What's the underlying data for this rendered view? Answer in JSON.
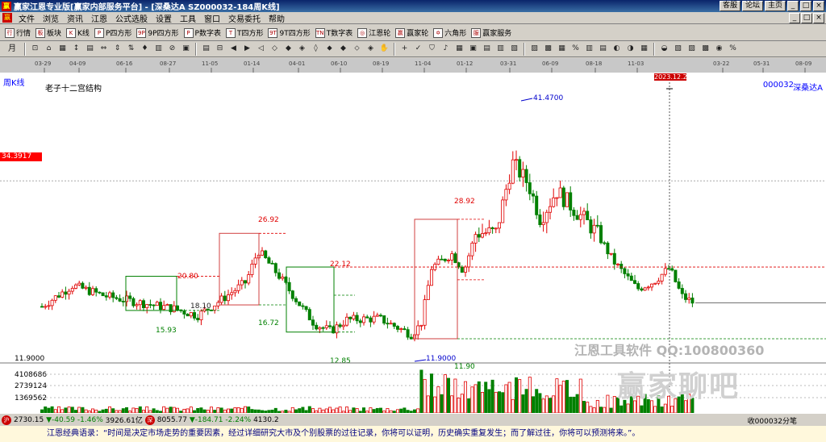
{
  "window": {
    "title": "赢家江恩专业版[赢家内部服务平台] - [深桑达A  SZ000032-184周K线]",
    "buttons": [
      "客服",
      "论坛",
      "主页"
    ],
    "controls": [
      "_",
      "□",
      "×"
    ]
  },
  "menu": {
    "items": [
      "文件",
      "浏览",
      "资讯",
      "江恩",
      "公式选股",
      "设置",
      "工具",
      "窗口",
      "交易委托",
      "帮助"
    ]
  },
  "toolbar1": {
    "items": [
      {
        "icon": "行",
        "label": "行情"
      },
      {
        "icon": "板",
        "label": "板块"
      },
      {
        "icon": "K",
        "label": "K线"
      },
      {
        "icon": "P",
        "label": "P四方形"
      },
      {
        "icon": "9P",
        "label": "9P四方形"
      },
      {
        "icon": "P",
        "label": "P数字表"
      },
      {
        "icon": "T",
        "label": "T四方形"
      },
      {
        "icon": "9T",
        "label": "9T四方形"
      },
      {
        "icon": "TN",
        "label": "T数字表"
      },
      {
        "icon": "◎",
        "label": "江恩轮"
      },
      {
        "icon": "赢",
        "label": "赢家轮"
      },
      {
        "icon": "✡",
        "label": "六角形"
      },
      {
        "icon": "服",
        "label": "赢家服务"
      }
    ]
  },
  "toolbar2": {
    "period_label": "月",
    "icons": [
      "⊡",
      "⌂",
      "▦",
      "↕",
      "▤",
      "⇔",
      "⇕",
      "⇅",
      "♦",
      "▥",
      "⊘",
      "▣",
      "▤",
      "⊟",
      "◀",
      "▶",
      "◁",
      "◇",
      "◆",
      "◈",
      "◊",
      "⬥",
      "◆",
      "⬦",
      "◈",
      "✋",
      "+",
      "✓",
      "⛉",
      "♪",
      "▦",
      "▣",
      "▤",
      "▥",
      "▧",
      "▨",
      "▩",
      "▦",
      "%",
      "▥",
      "▤",
      "◐",
      "◑",
      "▦",
      "◒",
      "▧",
      "▨",
      "▩",
      "◉",
      "%"
    ]
  },
  "chart": {
    "period": "周K线",
    "structure_title": "老子十二宫结构",
    "stock_code": "000032",
    "stock_name": "深桑达A",
    "crosshair_date": "2023.12.22",
    "current_price_tag": "34.3917",
    "time_axis_labels": [
      "03-29",
      "04-09",
      "06-16",
      "08-27",
      "11-05",
      "01-14",
      "04-01",
      "06-10",
      "08-19",
      "11-04",
      "01-12",
      "03-31",
      "06-09",
      "08-18",
      "11-03",
      "03-22",
      "05-31",
      "08-09"
    ],
    "price_label_low": "11.9000",
    "volume_labels": [
      "4108686",
      "2739124",
      "1369562"
    ],
    "annotations": {
      "peak": "41.4700",
      "low": "11.9000",
      "box1_top": "20.80",
      "box1_bottom": "15.93",
      "box2_top": "26.92",
      "box2_bottom": "16.72",
      "box3_top": "22.12",
      "box3_bottom": "12.85",
      "box4_top": "28.92",
      "box4_bottom": "11.90",
      "mid_label": "18.10"
    },
    "watermark": "江恩工具软件  QQ:100800360",
    "watermark2": "赢家聊吧",
    "colors": {
      "up": "#e00000",
      "down": "#008000",
      "box_up": "#d04040",
      "box_down": "#008000"
    }
  },
  "chart_data": {
    "type": "candlestick",
    "title": "老子十二宫结构",
    "annotations": [
      "41.4700",
      "11.9000",
      "28.92",
      "26.92",
      "22.12",
      "20.80",
      "16.72",
      "15.93",
      "12.85",
      "11.90"
    ]
  },
  "status": {
    "index1_value": "2730.15",
    "index1_change": "-40.59",
    "index1_pct": "-1.46%",
    "index1_amount": "3926.61亿",
    "index2_value": "8055.77",
    "index2_change": "-184.71",
    "index2_pct": "-2.24%",
    "index2_amount": "4130.2",
    "message": "收000032分笔"
  },
  "quote": {
    "text": "江恩经典语录：“时间是决定市场走势的重要因素，经过详细研究大市及个别股票的过往记录，你将可以证明，历史确实重复发生；而了解过往，你将可以预测将来。”。"
  }
}
